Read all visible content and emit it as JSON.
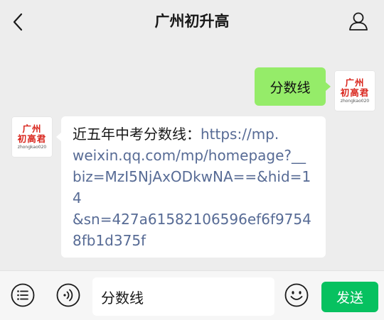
{
  "header": {
    "title": "广州初升高"
  },
  "avatar": {
    "line1": "广州",
    "line2": "初高君",
    "line3": "zhongkao020"
  },
  "messages": {
    "sent": {
      "text": "分数线"
    },
    "received": {
      "prefix": "近五年中考分数线：",
      "link_lines": [
        "https://mp.",
        "weixin.qq.com/mp/homepage?__",
        "biz=MzI5NjAxODkwNA==&hid=1",
        "4",
        "&sn=427a61582106596ef6f9754",
        "8fb1d375f"
      ]
    }
  },
  "composer": {
    "input_value": "分数线",
    "send_label": "发送"
  },
  "icons": {
    "back": "chevron-left-icon",
    "profile": "user-icon",
    "menu": "list-menu-icon",
    "voice": "voice-icon",
    "emoji": "smile-icon"
  },
  "colors": {
    "background": "#ededed",
    "sent_bubble": "#95ec69",
    "link": "#576b95",
    "send_button": "#07c160",
    "avatar_text": "#d9251c"
  }
}
